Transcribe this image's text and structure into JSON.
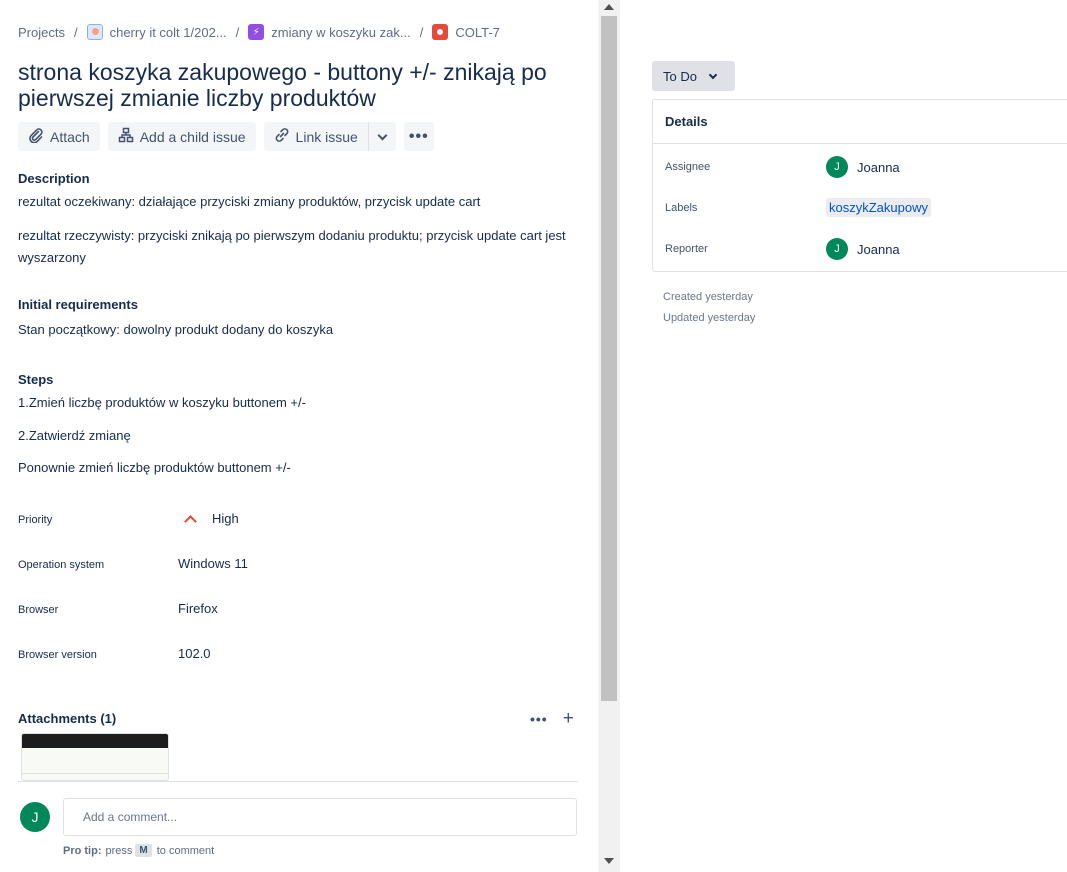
{
  "breadcrumb": {
    "projects": "Projects",
    "project": "cherry it colt 1/202...",
    "epic": "zmiany w koszyku zak...",
    "issue_key": "COLT-7",
    "separator": "/"
  },
  "issue": {
    "title": "strona koszyka zakupowego - buttony +/- znikają po pierwszej zmianie liczby produktów"
  },
  "toolbar": {
    "attach": "Attach",
    "add_child": "Add a child issue",
    "link_issue": "Link issue",
    "more": "•••"
  },
  "description": {
    "heading": "Description",
    "line1": "rezultat oczekiwany: działające przyciski zmiany produktów, przycisk update cart",
    "line2": "rezultat rzeczywisty: przyciski znikają po pierwszym dodaniu produktu; przycisk update cart jest wyszarzony"
  },
  "initial": {
    "heading": "Initial requirements",
    "text": "Stan początkowy: dowolny produkt dodany do koszyka"
  },
  "steps": {
    "heading": "Steps",
    "step1": "1.Zmień liczbę produktów w koszyku buttonem +/-",
    "step2": "2.Zatwierdź zmianę",
    "step3": "Ponownie zmień liczbę produktów buttonem +/-"
  },
  "fields": {
    "priority_label": "Priority",
    "priority_value": "High",
    "os_label": "Operation system",
    "os_value": "Windows 11",
    "browser_label": "Browser",
    "browser_value": "Firefox",
    "browser_version_label": "Browser version",
    "browser_version_value": "102.0"
  },
  "attachments": {
    "heading": "Attachments (1)",
    "more": "•••",
    "add": "+"
  },
  "comment": {
    "avatar_initial": "J",
    "placeholder": "Add a comment...",
    "protip_bold": "Pro tip:",
    "protip_press": "press",
    "protip_key": "M",
    "protip_rest": "to comment"
  },
  "status": {
    "label": "To Do"
  },
  "details": {
    "heading": "Details",
    "assignee_label": "Assignee",
    "assignee_initial": "J",
    "assignee_name": "Joanna",
    "labels_label": "Labels",
    "labels_value": "koszykZakupowy",
    "reporter_label": "Reporter",
    "reporter_initial": "J",
    "reporter_name": "Joanna"
  },
  "meta": {
    "created": "Created yesterday",
    "updated": "Updated yesterday"
  },
  "colors": {
    "avatar": "#00875a",
    "priority_high": "#e5493a",
    "link": "#0052cc"
  }
}
